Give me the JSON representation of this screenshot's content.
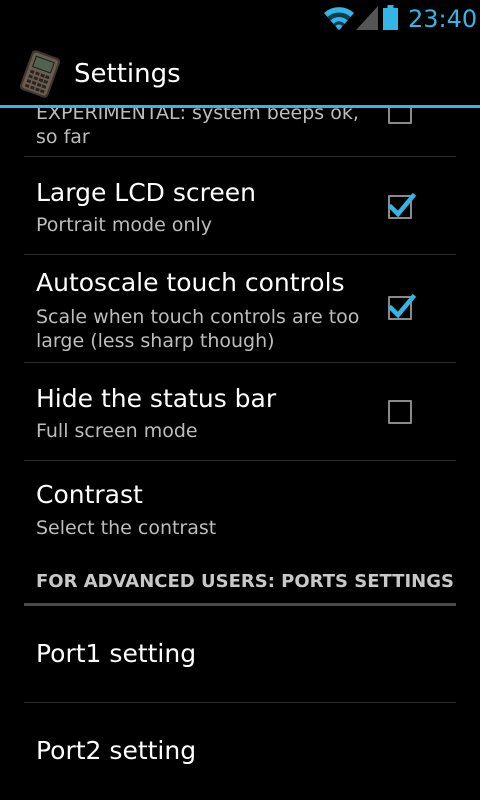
{
  "status_bar": {
    "time": "23:40",
    "icons": [
      "wifi-icon",
      "signal-icon",
      "battery-icon"
    ],
    "accent_color": "#33b5e5"
  },
  "action_bar": {
    "title": "Settings",
    "icon": "handheld-device-app-icon",
    "accent_color": "#33b5e5"
  },
  "preferences": [
    {
      "title": "",
      "summary": "EXPERIMENTAL: system beeps ok, so far",
      "checkbox": true,
      "checked": false
    },
    {
      "title": "Large LCD screen",
      "summary": "Portrait mode only",
      "checkbox": true,
      "checked": true
    },
    {
      "title": "Autoscale touch controls",
      "summary": "Scale when touch controls are too large (less sharp though)",
      "checkbox": true,
      "checked": true
    },
    {
      "title": "Hide the status bar",
      "summary": "Full screen mode",
      "checkbox": true,
      "checked": false
    },
    {
      "title": "Contrast",
      "summary": "Select the contrast",
      "checkbox": false,
      "checked": false
    }
  ],
  "category": {
    "label": "FOR ADVANCED USERS: PORTS SETTINGS"
  },
  "ports": [
    {
      "title": "Port1 setting"
    },
    {
      "title": "Port2 setting"
    }
  ]
}
